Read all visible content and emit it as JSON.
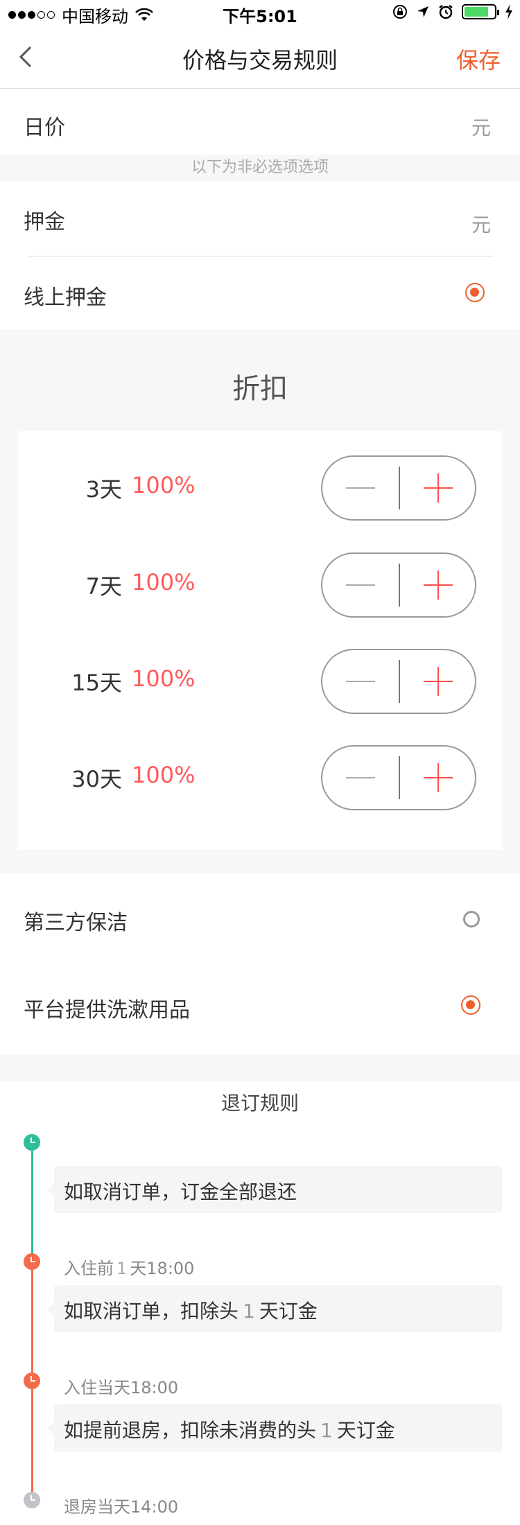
{
  "status_bar": {
    "carrier": "中国移动",
    "time": "下午5:01"
  },
  "nav": {
    "title": "价格与交易规则",
    "save_label": "保存"
  },
  "daily_price": {
    "label": "日价",
    "unit": "元"
  },
  "optional_hint": "以下为非必选项选项",
  "deposit": {
    "label": "押金",
    "unit": "元"
  },
  "online_deposit": {
    "label": "线上押金",
    "checked": true
  },
  "discount": {
    "title": "折扣",
    "rows": [
      {
        "days": "3天",
        "percent": "100%"
      },
      {
        "days": "7天",
        "percent": "100%"
      },
      {
        "days": "15天",
        "percent": "100%"
      },
      {
        "days": "30天",
        "percent": "100%"
      }
    ]
  },
  "third_party_cleaning": {
    "label": "第三方保洁",
    "checked": false
  },
  "toiletries": {
    "label": "平台提供洗漱用品",
    "checked": true
  },
  "refund": {
    "title": "退订规则",
    "rules": [
      {
        "text": "如取消订单，订金全部退还"
      },
      {
        "time_prefix": "入住前",
        "time_num": "1",
        "time_suffix": "天18:00",
        "text_prefix": "如取消订单，扣除头",
        "text_num": "1",
        "text_suffix": "天订金"
      },
      {
        "time": "入住当天18:00",
        "text_prefix": "如提前退房，扣除未消费的头",
        "text_num": "1",
        "text_suffix": "天订金"
      },
      {
        "time": "退房当天14:00"
      }
    ]
  },
  "colors": {
    "accent": "#f0602f",
    "percent": "#ff5a5a",
    "timeline_green": "#2ebf99",
    "timeline_orange": "#f26b4b",
    "timeline_gray": "#c0c4c8"
  }
}
